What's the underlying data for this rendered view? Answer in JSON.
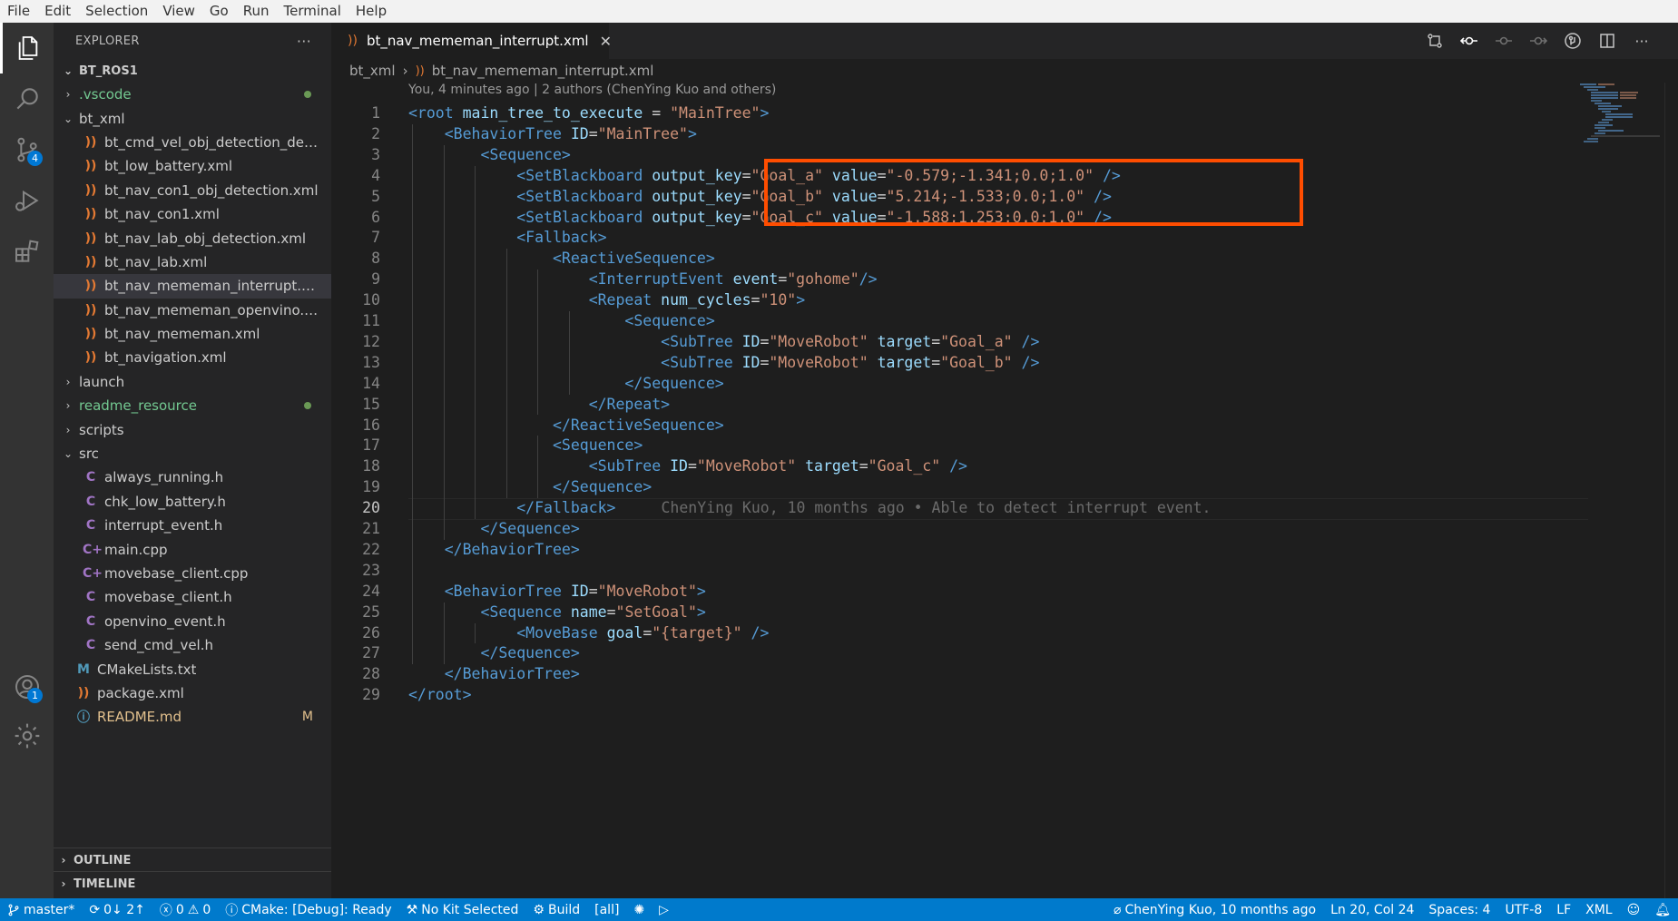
{
  "menu": [
    "File",
    "Edit",
    "Selection",
    "View",
    "Go",
    "Run",
    "Terminal",
    "Help"
  ],
  "activity_badges": {
    "scm": "4",
    "accounts": "1"
  },
  "explorer": {
    "title": "EXPLORER",
    "more": "···",
    "root": "BT_ROS1",
    "items": [
      {
        "label": ".vscode",
        "type": "folder-closed",
        "indent": 1,
        "color": "#73c991",
        "dot": true
      },
      {
        "label": "bt_xml",
        "type": "folder-open",
        "indent": 1,
        "color": "#cccccc"
      },
      {
        "label": "bt_cmd_vel_obj_detection_demo...",
        "type": "xml",
        "indent": 2,
        "color": "#cccccc"
      },
      {
        "label": "bt_low_battery.xml",
        "type": "xml",
        "indent": 2,
        "color": "#cccccc"
      },
      {
        "label": "bt_nav_con1_obj_detection.xml",
        "type": "xml",
        "indent": 2,
        "color": "#cccccc"
      },
      {
        "label": "bt_nav_con1.xml",
        "type": "xml",
        "indent": 2,
        "color": "#cccccc"
      },
      {
        "label": "bt_nav_lab_obj_detection.xml",
        "type": "xml",
        "indent": 2,
        "color": "#cccccc"
      },
      {
        "label": "bt_nav_lab.xml",
        "type": "xml",
        "indent": 2,
        "color": "#cccccc"
      },
      {
        "label": "bt_nav_mememan_interrupt.xml",
        "type": "xml",
        "indent": 2,
        "color": "#cccccc",
        "selected": true
      },
      {
        "label": "bt_nav_mememan_openvino.xml",
        "type": "xml",
        "indent": 2,
        "color": "#cccccc"
      },
      {
        "label": "bt_nav_mememan.xml",
        "type": "xml",
        "indent": 2,
        "color": "#cccccc"
      },
      {
        "label": "bt_navigation.xml",
        "type": "xml",
        "indent": 2,
        "color": "#cccccc"
      },
      {
        "label": "launch",
        "type": "folder-closed",
        "indent": 1,
        "color": "#cccccc"
      },
      {
        "label": "readme_resource",
        "type": "folder-closed",
        "indent": 1,
        "color": "#73c991",
        "dot": true
      },
      {
        "label": "scripts",
        "type": "folder-closed",
        "indent": 1,
        "color": "#cccccc"
      },
      {
        "label": "src",
        "type": "folder-open",
        "indent": 1,
        "color": "#cccccc"
      },
      {
        "label": "always_running.h",
        "type": "c",
        "indent": 2,
        "color": "#cccccc"
      },
      {
        "label": "chk_low_battery.h",
        "type": "c",
        "indent": 2,
        "color": "#cccccc"
      },
      {
        "label": "interrupt_event.h",
        "type": "c",
        "indent": 2,
        "color": "#cccccc"
      },
      {
        "label": "main.cpp",
        "type": "cpp",
        "indent": 2,
        "color": "#cccccc"
      },
      {
        "label": "movebase_client.cpp",
        "type": "cpp",
        "indent": 2,
        "color": "#cccccc"
      },
      {
        "label": "movebase_client.h",
        "type": "c",
        "indent": 2,
        "color": "#cccccc"
      },
      {
        "label": "openvino_event.h",
        "type": "c",
        "indent": 2,
        "color": "#cccccc"
      },
      {
        "label": "send_cmd_vel.h",
        "type": "c",
        "indent": 2,
        "color": "#cccccc"
      },
      {
        "label": "CMakeLists.txt",
        "type": "cmake",
        "indent": 1,
        "color": "#cccccc"
      },
      {
        "label": "package.xml",
        "type": "xml",
        "indent": 1,
        "color": "#cccccc"
      },
      {
        "label": "README.md",
        "type": "info",
        "indent": 1,
        "color": "#e2c08d",
        "mod": "M"
      }
    ],
    "outline": "OUTLINE",
    "timeline": "TIMELINE"
  },
  "editor": {
    "tab": "bt_nav_mememan_interrupt.xml",
    "breadcrumb": [
      "bt_xml",
      "bt_nav_mememan_interrupt.xml"
    ],
    "blame_header": "You, 4 minutes ago | 2 authors (ChenYing Kuo and others)",
    "inline_blame": "ChenYing Kuo, 10 months ago • Able to detect interrupt event.",
    "current_line": 20,
    "lines": [
      [
        [
          "t",
          "<root "
        ],
        [
          "a",
          "main_tree_to_execute "
        ],
        [
          "x",
          "= "
        ],
        [
          "s",
          "\"MainTree\""
        ],
        [
          "t",
          ">"
        ]
      ],
      [
        [
          "x",
          "    "
        ],
        [
          "t",
          "<BehaviorTree "
        ],
        [
          "a",
          "ID"
        ],
        [
          "x",
          "="
        ],
        [
          "s",
          "\"MainTree\""
        ],
        [
          "t",
          ">"
        ]
      ],
      [
        [
          "x",
          "        "
        ],
        [
          "t",
          "<Sequence>"
        ]
      ],
      [
        [
          "x",
          "            "
        ],
        [
          "t",
          "<SetBlackboard "
        ],
        [
          "a",
          "output_key"
        ],
        [
          "x",
          "="
        ],
        [
          "s",
          "\"Goal_a\" "
        ],
        [
          "a",
          "value"
        ],
        [
          "x",
          "="
        ],
        [
          "s",
          "\"-0.579;-1.341;0.0;1.0\" "
        ],
        [
          "t",
          "/>"
        ]
      ],
      [
        [
          "x",
          "            "
        ],
        [
          "t",
          "<SetBlackboard "
        ],
        [
          "a",
          "output_key"
        ],
        [
          "x",
          "="
        ],
        [
          "s",
          "\"Goal_b\" "
        ],
        [
          "a",
          "value"
        ],
        [
          "x",
          "="
        ],
        [
          "s",
          "\"5.214;-1.533;0.0;1.0\" "
        ],
        [
          "t",
          "/>"
        ]
      ],
      [
        [
          "x",
          "            "
        ],
        [
          "t",
          "<SetBlackboard "
        ],
        [
          "a",
          "output_key"
        ],
        [
          "x",
          "="
        ],
        [
          "s",
          "\"Goal_c\" "
        ],
        [
          "a",
          "value"
        ],
        [
          "x",
          "="
        ],
        [
          "s",
          "\"-1.588;1.253;0.0;1.0\" "
        ],
        [
          "t",
          "/>"
        ]
      ],
      [
        [
          "x",
          "            "
        ],
        [
          "t",
          "<Fallback>"
        ]
      ],
      [
        [
          "x",
          "                "
        ],
        [
          "t",
          "<ReactiveSequence>"
        ]
      ],
      [
        [
          "x",
          "                    "
        ],
        [
          "t",
          "<InterruptEvent "
        ],
        [
          "a",
          "event"
        ],
        [
          "x",
          "="
        ],
        [
          "s",
          "\"gohome\""
        ],
        [
          "t",
          "/>"
        ]
      ],
      [
        [
          "x",
          "                    "
        ],
        [
          "t",
          "<Repeat "
        ],
        [
          "a",
          "num_cycles"
        ],
        [
          "x",
          "="
        ],
        [
          "s",
          "\"10\""
        ],
        [
          "t",
          ">"
        ]
      ],
      [
        [
          "x",
          "                        "
        ],
        [
          "t",
          "<Sequence>"
        ]
      ],
      [
        [
          "x",
          "                            "
        ],
        [
          "t",
          "<SubTree "
        ],
        [
          "a",
          "ID"
        ],
        [
          "x",
          "="
        ],
        [
          "s",
          "\"MoveRobot\" "
        ],
        [
          "a",
          "target"
        ],
        [
          "x",
          "="
        ],
        [
          "s",
          "\"Goal_a\" "
        ],
        [
          "t",
          "/>"
        ]
      ],
      [
        [
          "x",
          "                            "
        ],
        [
          "t",
          "<SubTree "
        ],
        [
          "a",
          "ID"
        ],
        [
          "x",
          "="
        ],
        [
          "s",
          "\"MoveRobot\" "
        ],
        [
          "a",
          "target"
        ],
        [
          "x",
          "="
        ],
        [
          "s",
          "\"Goal_b\" "
        ],
        [
          "t",
          "/>"
        ]
      ],
      [
        [
          "x",
          "                        "
        ],
        [
          "t",
          "</Sequence>"
        ]
      ],
      [
        [
          "x",
          "                    "
        ],
        [
          "t",
          "</Repeat>"
        ]
      ],
      [
        [
          "x",
          "                "
        ],
        [
          "t",
          "</ReactiveSequence>"
        ]
      ],
      [
        [
          "x",
          "                "
        ],
        [
          "t",
          "<Sequence>"
        ]
      ],
      [
        [
          "x",
          "                    "
        ],
        [
          "t",
          "<SubTree "
        ],
        [
          "a",
          "ID"
        ],
        [
          "x",
          "="
        ],
        [
          "s",
          "\"MoveRobot\" "
        ],
        [
          "a",
          "target"
        ],
        [
          "x",
          "="
        ],
        [
          "s",
          "\"Goal_c\" "
        ],
        [
          "t",
          "/>"
        ]
      ],
      [
        [
          "x",
          "                "
        ],
        [
          "t",
          "</Sequence>"
        ]
      ],
      [
        [
          "x",
          "            "
        ],
        [
          "t",
          "</Fallback>"
        ]
      ],
      [
        [
          "x",
          "        "
        ],
        [
          "t",
          "</Sequence>"
        ]
      ],
      [
        [
          "x",
          "    "
        ],
        [
          "t",
          "</BehaviorTree>"
        ]
      ],
      [],
      [
        [
          "x",
          "    "
        ],
        [
          "t",
          "<BehaviorTree "
        ],
        [
          "a",
          "ID"
        ],
        [
          "x",
          "="
        ],
        [
          "s",
          "\"MoveRobot\""
        ],
        [
          "t",
          ">"
        ]
      ],
      [
        [
          "x",
          "        "
        ],
        [
          "t",
          "<Sequence "
        ],
        [
          "a",
          "name"
        ],
        [
          "x",
          "="
        ],
        [
          "s",
          "\"SetGoal\""
        ],
        [
          "t",
          ">"
        ]
      ],
      [
        [
          "x",
          "            "
        ],
        [
          "t",
          "<MoveBase "
        ],
        [
          "a",
          "goal"
        ],
        [
          "x",
          "="
        ],
        [
          "s",
          "\"{target}\" "
        ],
        [
          "t",
          "/>"
        ]
      ],
      [
        [
          "x",
          "        "
        ],
        [
          "t",
          "</Sequence>"
        ]
      ],
      [
        [
          "x",
          "    "
        ],
        [
          "t",
          "</BehaviorTree>"
        ]
      ],
      [
        [
          "t",
          "</root>"
        ]
      ]
    ]
  },
  "status": {
    "branch": "master*",
    "sync": "0↓ 2↑",
    "errors": "0",
    "warnings": "0",
    "cmake": "CMake: [Debug]: Ready",
    "kit": "No Kit Selected",
    "build": "Build",
    "target": "[all]",
    "blame": "ChenYing Kuo, 10 months ago",
    "position": "Ln 20, Col 24",
    "spaces": "Spaces: 4",
    "encoding": "UTF-8",
    "eol": "LF",
    "language": "XML"
  }
}
